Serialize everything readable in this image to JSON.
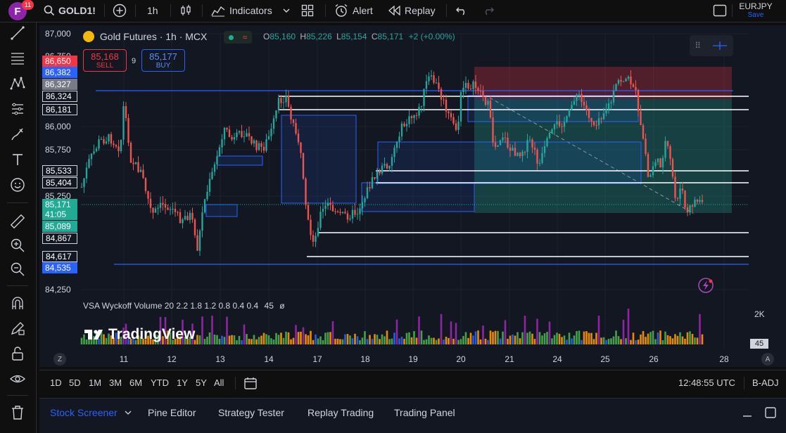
{
  "topbar": {
    "avatar_letter": "F",
    "notif_count": "11",
    "symbol": "GOLD1!",
    "interval": "1h",
    "indicators_label": "Indicators",
    "alert_label": "Alert",
    "replay_label": "Replay",
    "layout_name": "EURJPY",
    "save_label": "Save"
  },
  "legend": {
    "title": "Gold Futures · 1h · MCX",
    "open_key": "O",
    "open": "85,160",
    "high_key": "H",
    "high": "85,226",
    "low_key": "L",
    "low": "85,154",
    "close_key": "C",
    "close": "85,171",
    "change": "+2 (+0.00%)",
    "sell_price": "85,168",
    "sell_label": "SELL",
    "spread": "9",
    "buy_price": "85,177",
    "buy_label": "BUY"
  },
  "indicator": {
    "label": "VSA Wyckoff Volume 20 2.2 1.8 1.2 0.8 0.4 0.4",
    "value": "45",
    "null_symbol": "ø",
    "scale_label": "2K",
    "last_value": "45"
  },
  "watermark": "TradingView",
  "price_axis": {
    "ticks": [
      "87,000",
      "86,750",
      "86,000",
      "85,750",
      "85,250",
      "84,250"
    ],
    "labels": [
      {
        "text": "86,650",
        "bg": "#f23645"
      },
      {
        "text": "86,382",
        "bg": "#2962ff"
      },
      {
        "text": "86,327",
        "bg": "#787b86"
      },
      {
        "text": "86,324",
        "bg": "#131722"
      },
      {
        "text": "86,181",
        "bg": "#131722"
      },
      {
        "text": "85,533",
        "bg": "#131722"
      },
      {
        "text": "85,404",
        "bg": "#131722"
      },
      {
        "text": "85,171",
        "bg": "#22ab94"
      },
      {
        "text": "41:05",
        "bg": "#22ab94"
      },
      {
        "text": "85,089",
        "bg": "#22ab94"
      },
      {
        "text": "84,867",
        "bg": "#131722"
      },
      {
        "text": "84,617",
        "bg": "#131722"
      },
      {
        "text": "84,535",
        "bg": "#2962ff"
      }
    ]
  },
  "time_axis": [
    "11",
    "12",
    "13",
    "14",
    "17",
    "18",
    "19",
    "20",
    "21",
    "24",
    "25",
    "26",
    "28"
  ],
  "axis_buttons": {
    "left": "Z",
    "right": "A"
  },
  "timeframes": [
    "1D",
    "5D",
    "1M",
    "3M",
    "6M",
    "YTD",
    "1Y",
    "5Y",
    "All"
  ],
  "clock": "12:48:55 UTC",
  "adjustment": "B-ADJ",
  "bottom_tabs": [
    "Stock Screener",
    "Pine Editor",
    "Strategy Tester",
    "Replay Trading",
    "Trading Panel"
  ],
  "colors": {
    "bull": "#26a69a",
    "bear": "#ef5350",
    "accent": "#2962ff",
    "background": "#131722"
  },
  "chart_data": {
    "type": "candlestick",
    "x": [
      "11",
      "12",
      "13",
      "14",
      "17",
      "18",
      "19",
      "20",
      "21",
      "24",
      "25",
      "26",
      "28"
    ],
    "ylim": [
      84250,
      87000
    ],
    "last_close": 85171,
    "horizontal_levels": [
      86324,
      86181,
      85533,
      85404,
      84867,
      84617
    ],
    "trend_lines": [
      86382,
      84535
    ],
    "grid": true
  }
}
